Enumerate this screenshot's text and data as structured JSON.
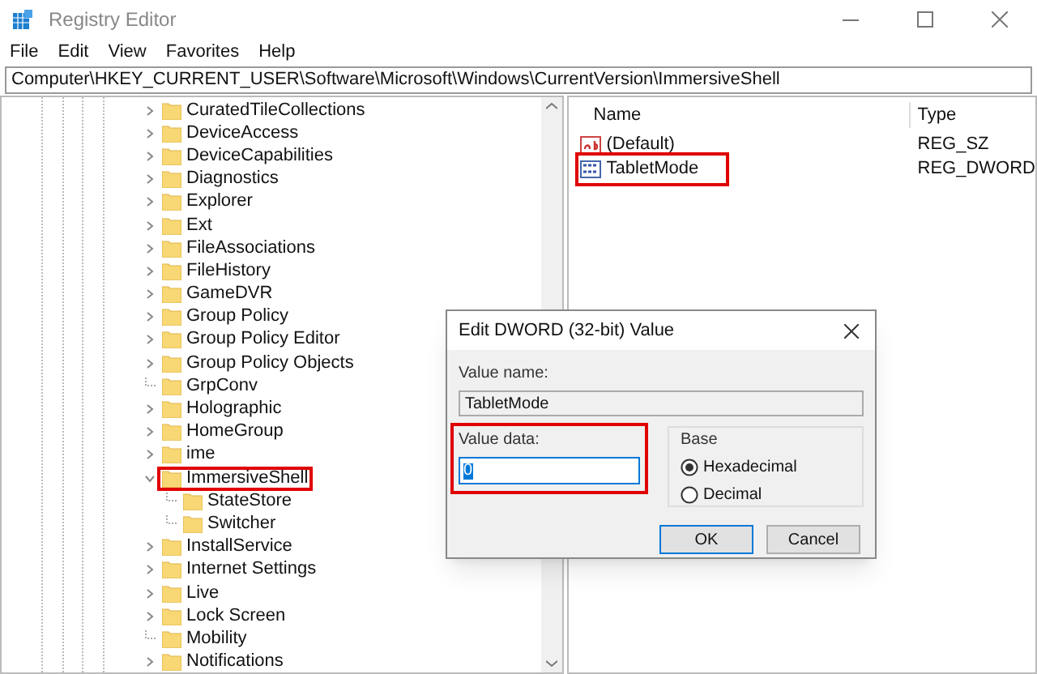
{
  "window": {
    "title": "Registry Editor"
  },
  "menu": [
    "File",
    "Edit",
    "View",
    "Favorites",
    "Help"
  ],
  "address": "Computer\\HKEY_CURRENT_USER\\Software\\Microsoft\\Windows\\CurrentVersion\\ImmersiveShell",
  "tree": [
    {
      "label": "CuratedTileCollections",
      "has_children": true,
      "expanded": false,
      "highlighted": false
    },
    {
      "label": "DeviceAccess",
      "has_children": true,
      "expanded": false,
      "highlighted": false
    },
    {
      "label": "DeviceCapabilities",
      "has_children": true,
      "expanded": false,
      "highlighted": false
    },
    {
      "label": "Diagnostics",
      "has_children": true,
      "expanded": false,
      "highlighted": false
    },
    {
      "label": "Explorer",
      "has_children": true,
      "expanded": false,
      "highlighted": false
    },
    {
      "label": "Ext",
      "has_children": true,
      "expanded": false,
      "highlighted": false
    },
    {
      "label": "FileAssociations",
      "has_children": true,
      "expanded": false,
      "highlighted": false
    },
    {
      "label": "FileHistory",
      "has_children": true,
      "expanded": false,
      "highlighted": false
    },
    {
      "label": "GameDVR",
      "has_children": true,
      "expanded": false,
      "highlighted": false
    },
    {
      "label": "Group Policy",
      "has_children": true,
      "expanded": false,
      "highlighted": false
    },
    {
      "label": "Group Policy Editor",
      "has_children": true,
      "expanded": false,
      "highlighted": false
    },
    {
      "label": "Group Policy Objects",
      "has_children": true,
      "expanded": false,
      "highlighted": false
    },
    {
      "label": "GrpConv",
      "has_children": false,
      "highlighted": false
    },
    {
      "label": "Holographic",
      "has_children": true,
      "expanded": false,
      "highlighted": false
    },
    {
      "label": "HomeGroup",
      "has_children": true,
      "expanded": false,
      "highlighted": false
    },
    {
      "label": "ime",
      "has_children": true,
      "expanded": false,
      "highlighted": false
    },
    {
      "label": "ImmersiveShell",
      "has_children": true,
      "expanded": true,
      "highlighted": true,
      "children": [
        {
          "label": "StateStore",
          "has_children": false,
          "highlighted": false
        },
        {
          "label": "Switcher",
          "has_children": false,
          "highlighted": false
        }
      ]
    },
    {
      "label": "InstallService",
      "has_children": true,
      "expanded": false,
      "highlighted": false
    },
    {
      "label": "Internet Settings",
      "has_children": true,
      "expanded": false,
      "highlighted": false
    },
    {
      "label": "Live",
      "has_children": true,
      "expanded": false,
      "highlighted": false
    },
    {
      "label": "Lock Screen",
      "has_children": true,
      "expanded": false,
      "highlighted": false
    },
    {
      "label": "Mobility",
      "has_children": false,
      "highlighted": false
    },
    {
      "label": "Notifications",
      "has_children": true,
      "expanded": false,
      "highlighted": false
    }
  ],
  "values": {
    "columns": [
      "Name",
      "Type"
    ],
    "rows": [
      {
        "name": "(Default)",
        "type": "REG_SZ",
        "kind": "string",
        "highlighted": false
      },
      {
        "name": "TabletMode",
        "type": "REG_DWORD",
        "kind": "binary",
        "highlighted": true
      }
    ]
  },
  "dialog": {
    "title": "Edit DWORD (32-bit) Value",
    "value_name_label": "Value name:",
    "value_name": "TabletMode",
    "value_data_label": "Value data:",
    "value_data": "0",
    "value_data_highlighted": true,
    "base_label": "Base",
    "bases": [
      {
        "label": "Hexadecimal",
        "selected": true
      },
      {
        "label": "Decimal",
        "selected": false
      }
    ],
    "buttons": [
      "OK",
      "Cancel"
    ]
  }
}
